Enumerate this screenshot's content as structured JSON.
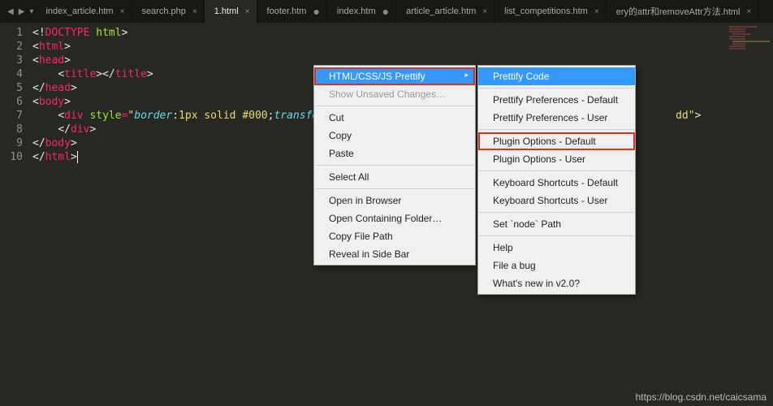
{
  "tabs": [
    {
      "label": "index_article.htm",
      "modified": false
    },
    {
      "label": "search.php",
      "modified": false
    },
    {
      "label": "1.html",
      "modified": false,
      "active": true
    },
    {
      "label": "footer.htm",
      "modified": true
    },
    {
      "label": "index.htm",
      "modified": true
    },
    {
      "label": "article_article.htm",
      "modified": false
    },
    {
      "label": "list_competitions.htm",
      "modified": false
    },
    {
      "label": "ery的attr和removeAttr方法.html",
      "modified": false
    }
  ],
  "code": {
    "line_count": 10,
    "doctype": "<!DOCTYPE html>",
    "style_value": "border:1px solid #000;transfor",
    "style_tail": "dd",
    "prop1": "border",
    "prop2": "transfor"
  },
  "context_menu": {
    "items": [
      {
        "label": "HTML/CSS/JS Prettify",
        "highlighted": true,
        "red": true,
        "sub": true
      },
      {
        "label": "Show Unsaved Changes…",
        "disabled": true
      },
      {
        "sep": true
      },
      {
        "label": "Cut"
      },
      {
        "label": "Copy"
      },
      {
        "label": "Paste"
      },
      {
        "sep": true
      },
      {
        "label": "Select All"
      },
      {
        "sep": true
      },
      {
        "label": "Open in Browser"
      },
      {
        "label": "Open Containing Folder…"
      },
      {
        "label": "Copy File Path"
      },
      {
        "label": "Reveal in Side Bar"
      }
    ]
  },
  "submenu": {
    "items": [
      {
        "label": "Prettify Code",
        "highlighted": true
      },
      {
        "sep": true
      },
      {
        "label": "Prettify Preferences - Default"
      },
      {
        "label": "Prettify Preferences - User"
      },
      {
        "sep": true
      },
      {
        "label": "Plugin Options - Default",
        "red": true
      },
      {
        "label": "Plugin Options - User"
      },
      {
        "sep": true
      },
      {
        "label": "Keyboard Shortcuts - Default"
      },
      {
        "label": "Keyboard Shortcuts - User"
      },
      {
        "sep": true
      },
      {
        "label": "Set `node` Path"
      },
      {
        "sep": true
      },
      {
        "label": "Help"
      },
      {
        "label": "File a bug"
      },
      {
        "label": "What's new in v2.0?"
      }
    ]
  },
  "watermark": "https://blog.csdn.net/caicsama"
}
